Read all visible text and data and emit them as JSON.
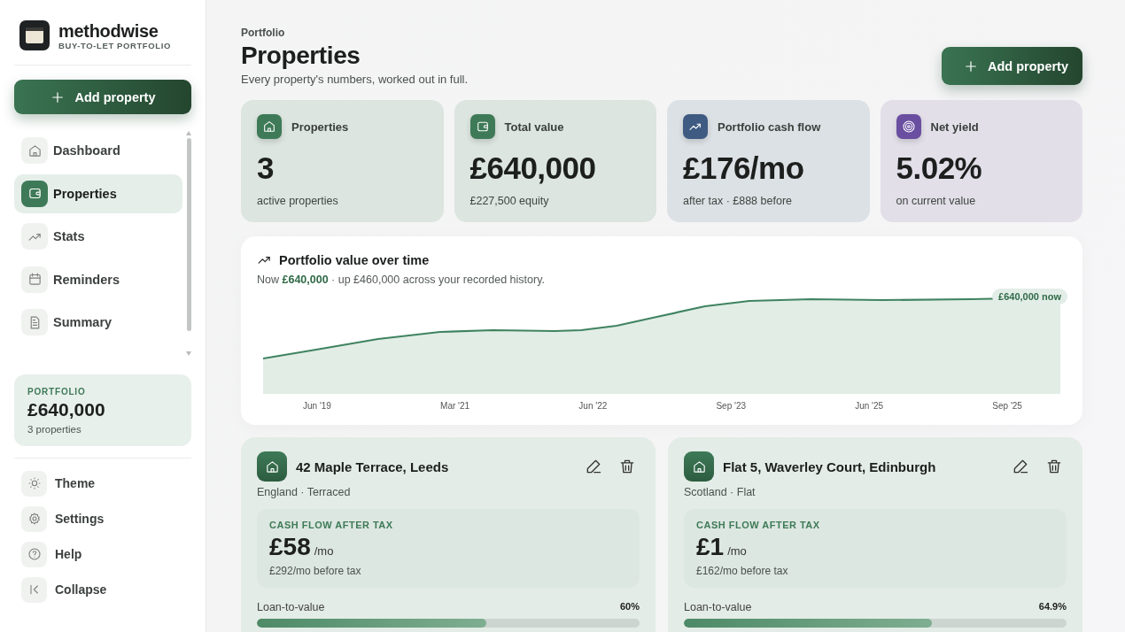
{
  "brand": {
    "name": "methodwise",
    "tagline": "BUY-TO-LET PORTFOLIO"
  },
  "sidebar": {
    "add_button": "Add property",
    "nav": [
      {
        "label": "Dashboard",
        "selected": false
      },
      {
        "label": "Properties",
        "selected": true
      },
      {
        "label": "Stats",
        "selected": false
      },
      {
        "label": "Reminders",
        "selected": false
      },
      {
        "label": "Summary",
        "selected": false
      }
    ],
    "portfolio": {
      "label": "PORTFOLIO",
      "value": "£640,000",
      "count": "3 properties"
    },
    "footer": [
      {
        "label": "Theme"
      },
      {
        "label": "Settings"
      },
      {
        "label": "Help"
      },
      {
        "label": "Collapse"
      }
    ]
  },
  "header": {
    "breadcrumb": "Portfolio",
    "title": "Properties",
    "subtitle": "Every property's numbers, worked out in full.",
    "add_button": "Add property"
  },
  "stats": [
    {
      "label": "Properties",
      "value": "3",
      "note": "active properties",
      "color": "#3e7a57"
    },
    {
      "label": "Total value",
      "value": "£640,000",
      "note": "£227,500 equity",
      "color": "#3e7a57"
    },
    {
      "label": "Portfolio cash flow",
      "value": "£176/mo",
      "note": "after tax · £888 before",
      "color": "#3f5b82"
    },
    {
      "label": "Net yield",
      "value": "5.02%",
      "note": "on current value",
      "color": "#6a4ea0"
    }
  ],
  "chart": {
    "title": "Portfolio value over time",
    "summary": "Now **£640,000** · up £460,000 across your recorded history.",
    "badge": "£640,000 now",
    "x_labels": [
      "Jun '19",
      "Mar '21",
      "Jun '22",
      "Sep '23",
      "Jun '25",
      "Sep '25"
    ]
  },
  "properties": [
    {
      "name": "42 Maple Terrace, Leeds",
      "meta": "England · Terraced",
      "cash_label": "CASH FLOW AFTER TAX",
      "cash": "£58",
      "unit": "/mo",
      "before": "£292/mo before tax",
      "ltv_label": "Loan-to-value",
      "ltv": "60%",
      "level": 0.6
    },
    {
      "name": "Flat 5, Waverley Court, Edinburgh",
      "meta": "Scotland · Flat",
      "cash_label": "CASH FLOW AFTER TAX",
      "cash": "£1",
      "unit": "/mo",
      "before": "£162/mo before tax",
      "ltv_label": "Loan-to-value",
      "ltv": "64.9%",
      "level": 0.649
    }
  ]
}
